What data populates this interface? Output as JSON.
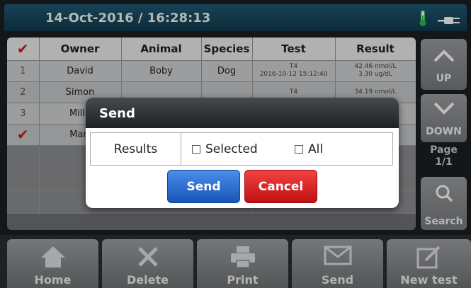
{
  "header": {
    "datetime": "14-Oct-2016 / 16:28:13",
    "thermometer_icon": "thermometer-icon",
    "power_icon": "plug-icon"
  },
  "table": {
    "columns": [
      "",
      "Owner",
      "Animal",
      "Species",
      "Test",
      "Result"
    ],
    "rows": [
      {
        "num": "1",
        "owner": "David",
        "animal": "Boby",
        "species": "Dog",
        "test_name": "T4",
        "test_date": "2016-10-12 15:12:40",
        "result_1": "42.46 nmol/L",
        "result_2": "3.30 ug/dL"
      },
      {
        "num": "2",
        "owner": "Simon",
        "animal": "",
        "species": "",
        "test_name": "T4",
        "test_date": "",
        "result_1": "34.19 nmol/L",
        "result_2": ""
      },
      {
        "num": "3",
        "owner": "Mille",
        "animal": "",
        "species": "",
        "test_name": "",
        "test_date": "",
        "result_1": "",
        "result_2": ""
      },
      {
        "num": "✔",
        "owner": "Mart",
        "animal": "",
        "species": "",
        "test_name": "",
        "test_date": "",
        "result_1": "",
        "result_2": ""
      }
    ],
    "header_check": "✔"
  },
  "side": {
    "up_label": "UP",
    "down_label": "DOWN",
    "page_label": "Page",
    "page_value": "1/1",
    "search_label": "Search"
  },
  "toolbar": {
    "home": "Home",
    "delete": "Delete",
    "print": "Print",
    "send": "Send",
    "new_test": "New test"
  },
  "dialog": {
    "title": "Send",
    "row_label": "Results",
    "option_selected": "Selected",
    "option_all": "All",
    "send_button": "Send",
    "cancel_button": "Cancel"
  },
  "colors": {
    "header_bg": "#1f5a74",
    "check_red": "#d11a1a",
    "send_blue": "#2f72d6",
    "cancel_red": "#d92222"
  }
}
